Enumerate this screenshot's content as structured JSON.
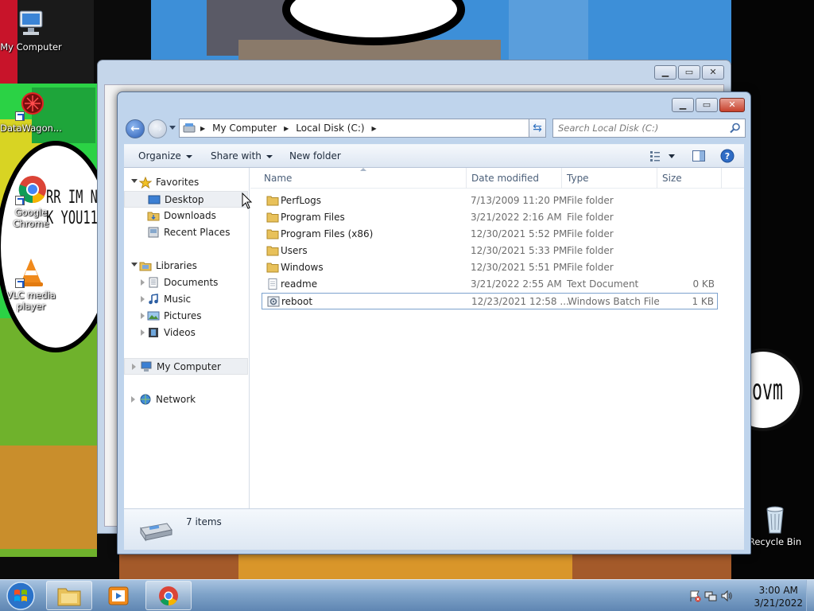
{
  "desktop": {
    "icons": [
      {
        "label": "My Computer"
      },
      {
        "label": "DataWagon..."
      },
      {
        "label": "Google Chrome"
      },
      {
        "label": "VLC media player"
      },
      {
        "label": "Recycle Bin"
      }
    ],
    "wallpaper_text": {
      "line1": "RR IM N",
      "line2": "K YOU11",
      "right": "ovm"
    }
  },
  "window": {
    "address": {
      "crumbs": [
        "My Computer",
        "Local Disk (C:)"
      ]
    },
    "search": {
      "placeholder": "Search Local Disk (C:)"
    },
    "commands": {
      "organize": "Organize",
      "share_with": "Share with",
      "new_folder": "New folder"
    },
    "nav": {
      "favorites": "Favorites",
      "favorites_items": [
        "Desktop",
        "Downloads",
        "Recent Places"
      ],
      "libraries": "Libraries",
      "libraries_items": [
        "Documents",
        "Music",
        "Pictures",
        "Videos"
      ],
      "computer": "My Computer",
      "network": "Network"
    },
    "columns": {
      "name": "Name",
      "date": "Date modified",
      "type": "Type",
      "size": "Size"
    },
    "files": [
      {
        "name": "PerfLogs",
        "date": "7/13/2009 11:20 PM",
        "type": "File folder",
        "size": "",
        "icon": "folder-icon"
      },
      {
        "name": "Program Files",
        "date": "3/21/2022 2:16 AM",
        "type": "File folder",
        "size": "",
        "icon": "folder-icon"
      },
      {
        "name": "Program Files (x86)",
        "date": "12/30/2021 5:52 PM",
        "type": "File folder",
        "size": "",
        "icon": "folder-icon"
      },
      {
        "name": "Users",
        "date": "12/30/2021 5:33 PM",
        "type": "File folder",
        "size": "",
        "icon": "folder-icon"
      },
      {
        "name": "Windows",
        "date": "12/30/2021 5:51 PM",
        "type": "File folder",
        "size": "",
        "icon": "folder-icon"
      },
      {
        "name": "readme",
        "date": "3/21/2022 2:55 AM",
        "type": "Text Document",
        "size": "0 KB",
        "icon": "text-document-icon"
      },
      {
        "name": "reboot",
        "date": "12/23/2021 12:58 ...",
        "type": "Windows Batch File",
        "size": "1 KB",
        "icon": "batch-file-icon"
      }
    ],
    "details": {
      "count": "7 items"
    }
  },
  "taskbar": {
    "clock": {
      "time": "3:00 AM",
      "date": "3/21/2022"
    }
  },
  "colors": {
    "accent": "#3a6ea5",
    "folder": "#e8c15a",
    "close": "#c7412c"
  }
}
